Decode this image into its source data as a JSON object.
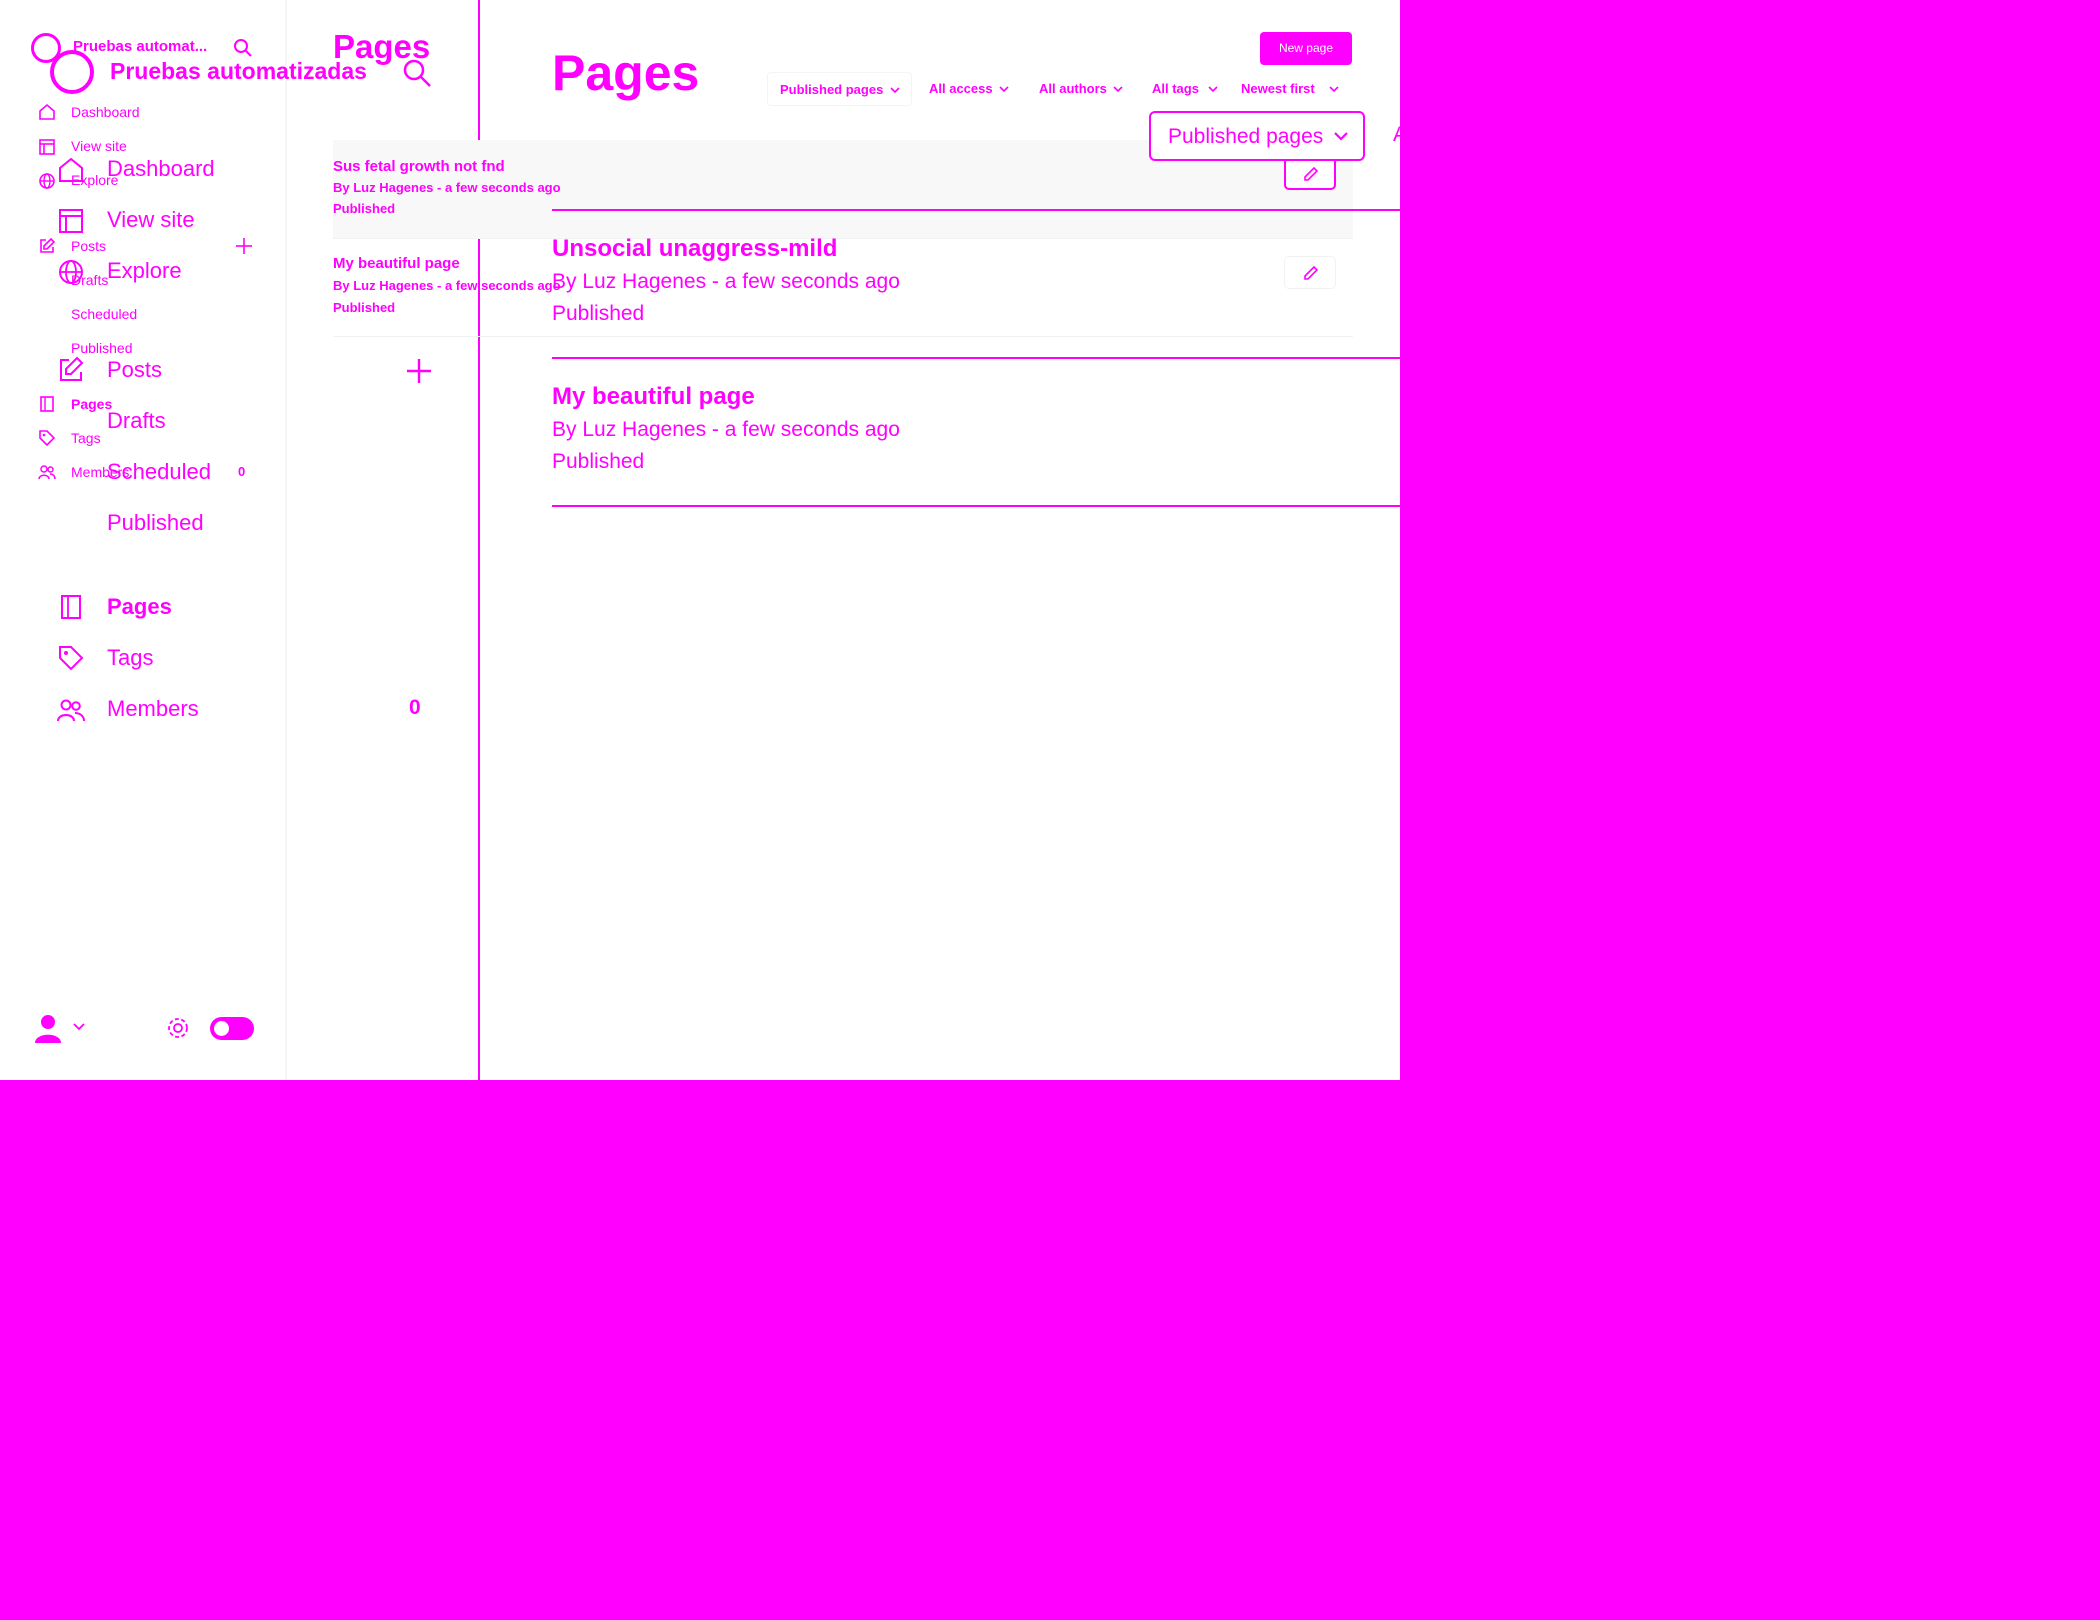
{
  "colors": {
    "accent": "#ff00ff",
    "background": "#ffffff"
  },
  "small_sidebar": {
    "site_title": "Pruebas automat...",
    "nav": {
      "dashboard": "Dashboard",
      "view_site": "View site",
      "explore": "Explore",
      "posts": "Posts",
      "drafts": "Drafts",
      "scheduled": "Scheduled",
      "published": "Published",
      "pages": "Pages",
      "tags": "Tags",
      "members": "Members",
      "members_count": "0"
    }
  },
  "large_sidebar": {
    "site_title": "Pruebas automatizadas",
    "nav": {
      "dashboard": "Dashboard",
      "view_site": "View site",
      "explore": "Explore",
      "posts": "Posts",
      "drafts": "Drafts",
      "scheduled": "Scheduled",
      "published": "Published",
      "pages": "Pages",
      "tags": "Tags",
      "members": "Members",
      "members_count": "0"
    }
  },
  "small_page": {
    "title": "Pages",
    "new_button": "New page",
    "filters": [
      "Published pages",
      "All access",
      "All authors",
      "All tags",
      "Newest first"
    ],
    "list": [
      {
        "title": "Sus fetal growth not fnd",
        "meta": "By Luz Hagenes - a few seconds ago",
        "status": "Published"
      },
      {
        "title": "My beautiful page",
        "meta": "By Luz Hagenes - a few seconds ago",
        "status": "Published"
      }
    ]
  },
  "large_page": {
    "title": "Pages",
    "filters": [
      "Published pages",
      "A"
    ],
    "list": [
      {
        "title": "Unsocial unaggress-mild",
        "meta": "By Luz Hagenes - a few seconds ago",
        "status": "Published"
      },
      {
        "title": "My beautiful page",
        "meta": "By Luz Hagenes - a few seconds ago",
        "status": "Published"
      }
    ]
  }
}
